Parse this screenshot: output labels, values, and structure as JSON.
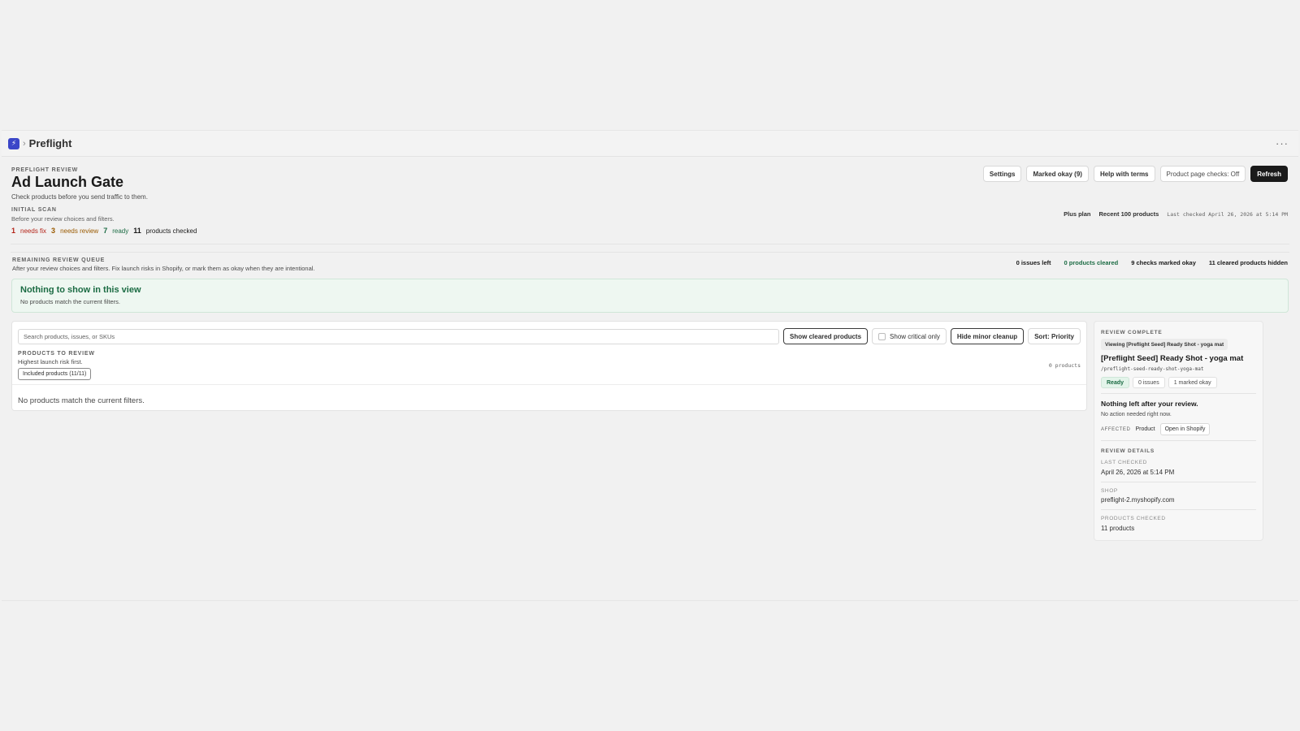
{
  "app": {
    "name": "Preflight",
    "icon": "preflight-logo-icon",
    "more_icon": "more-horizontal-icon"
  },
  "header": {
    "eyebrow": "PREFLIGHT REVIEW",
    "title": "Ad Launch Gate",
    "subtitle": "Check products before you send traffic to them.",
    "actions": {
      "settings": "Settings",
      "marked_okay": "Marked okay (9)",
      "help": "Help with terms",
      "product_checks": "Product page checks: Off",
      "refresh": "Refresh"
    }
  },
  "initial_scan": {
    "eyebrow": "INITIAL SCAN",
    "subtitle": "Before your review choices and filters.",
    "needs_fix_count": "1",
    "needs_fix_label": "needs fix",
    "needs_review_count": "3",
    "needs_review_label": "needs review",
    "ready_count": "7",
    "ready_label": "ready",
    "checked_count": "11",
    "checked_label": "products checked"
  },
  "meta": {
    "plan": "Plus plan",
    "scope": "Recent 100 products",
    "last_checked": "Last checked April 26, 2026 at 5:14 PM"
  },
  "queue": {
    "eyebrow": "REMAINING REVIEW QUEUE",
    "subtitle": "After your review choices and filters. Fix launch risks in Shopify, or mark them as okay when they are intentional.",
    "issues_left": "0 issues left",
    "products_cleared": "0 products cleared",
    "checks_marked_okay": "9 checks marked okay",
    "cleared_hidden": "11 cleared products hidden"
  },
  "empty_banner": {
    "title": "Nothing to show in this view",
    "subtitle": "No products match the current filters."
  },
  "filters": {
    "search_placeholder": "Search products, issues, or SKUs",
    "show_cleared": "Show cleared products",
    "show_critical": "Show critical only",
    "hide_minor": "Hide minor cleanup",
    "sort": "Sort: Priority"
  },
  "products": {
    "eyebrow": "PRODUCTS TO REVIEW",
    "subtitle": "Highest launch risk first.",
    "included_chip": "Included products (11/11)",
    "count": "0 products",
    "empty": "No products match the current filters."
  },
  "side": {
    "eyebrow": "REVIEW COMPLETE",
    "viewing": "Viewing [Preflight Seed] Ready Shot - yoga mat",
    "product_title": "[Preflight Seed] Ready Shot - yoga mat",
    "handle": "/preflight-seed-ready-shot-yoga-mat",
    "badge_ready": "Ready",
    "badge_issues": "0 issues",
    "badge_marked": "1 marked okay",
    "nothing_left_title": "Nothing left after your review.",
    "nothing_left_sub": "No action needed right now.",
    "affected_label": "AFFECTED",
    "affected_value": "Product",
    "open_shopify": "Open in Shopify",
    "details_eyebrow": "REVIEW DETAILS",
    "last_checked_label": "LAST CHECKED",
    "last_checked_value": "April 26, 2026 at 5:14 PM",
    "shop_label": "SHOP",
    "shop_value": "preflight-2.myshopify.com",
    "products_checked_label": "PRODUCTS CHECKED",
    "products_checked_value": "11 products"
  }
}
